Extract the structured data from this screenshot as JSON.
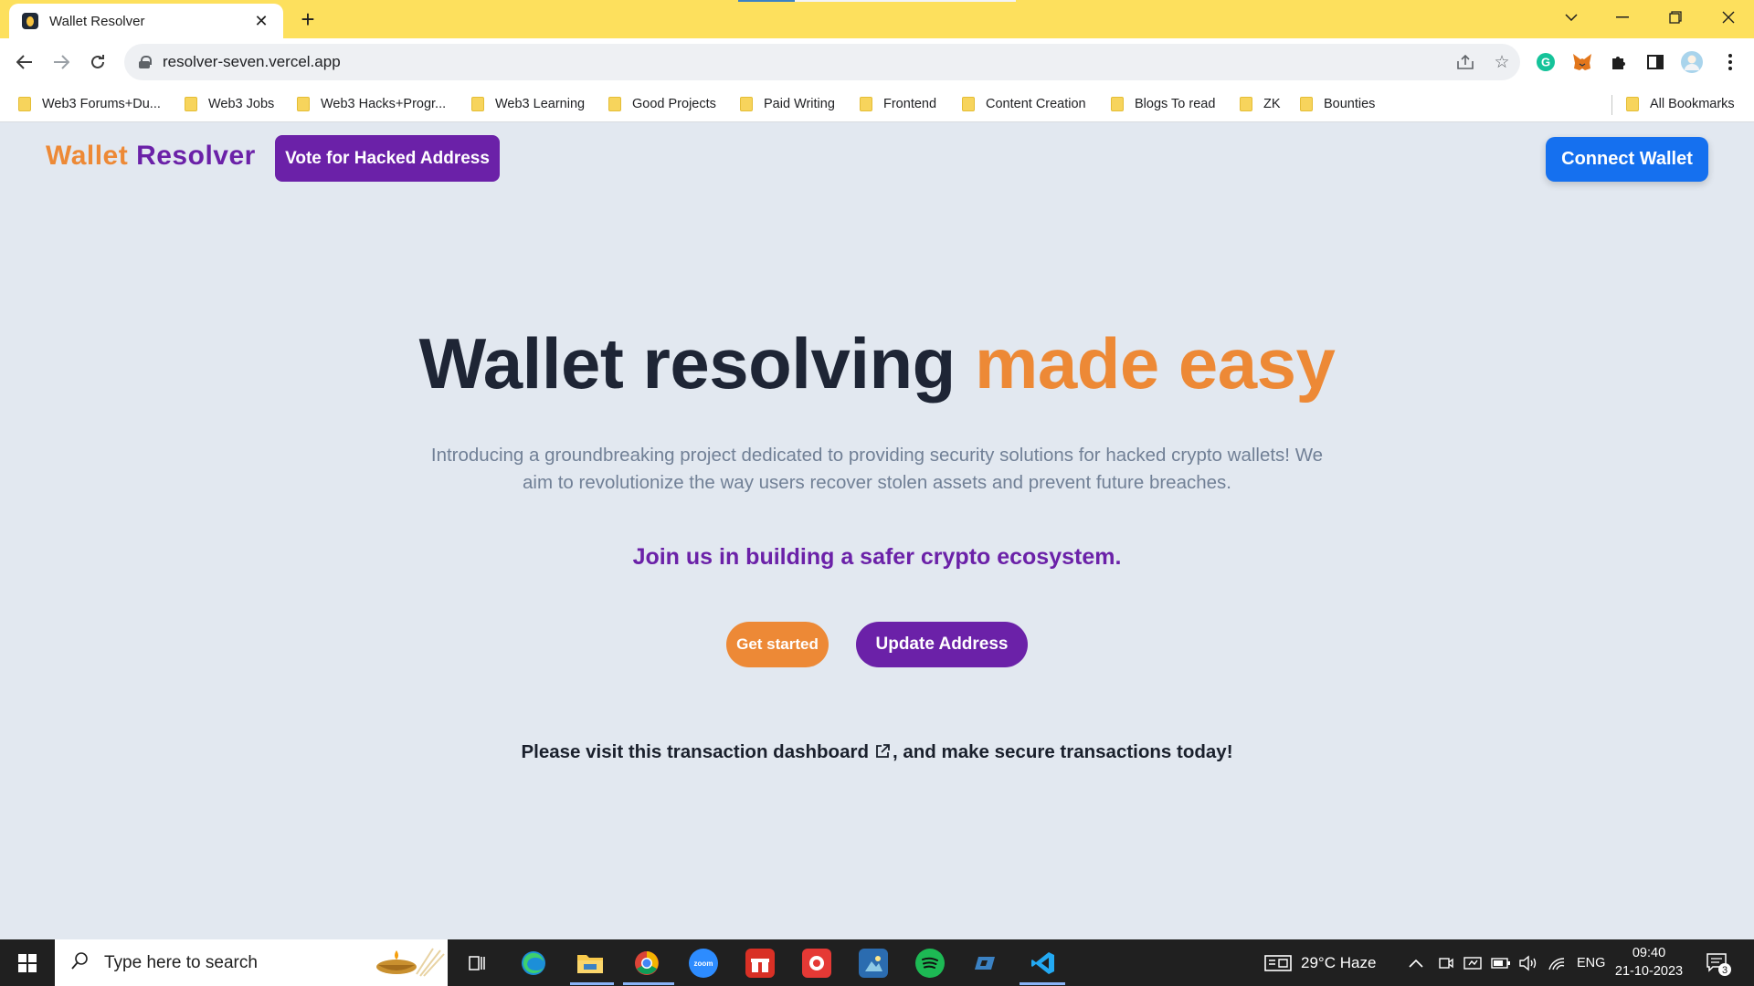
{
  "browser": {
    "tab_title": "Wallet Resolver",
    "url": "resolver-seven.vercel.app",
    "bookmarks": [
      "Web3 Forums+Du...",
      "Web3 Jobs",
      "Web3 Hacks+Progr...",
      "Web3 Learning",
      "Good Projects",
      "Paid Writing",
      "Frontend",
      "Content Creation",
      "Blogs To read",
      "ZK",
      "Bounties"
    ],
    "all_bookmarks": "All Bookmarks"
  },
  "nav": {
    "brand_first": "Wallet",
    "brand_second": "Resolver",
    "vote_label": "Vote for Hacked Address",
    "connect_label": "Connect Wallet"
  },
  "hero": {
    "title_main": "Wallet resolving",
    "title_accent": "made easy",
    "description": "Introducing a groundbreaking project dedicated to providing security solutions for hacked crypto wallets! We aim to revolutionize the way users recover stolen assets and prevent future breaches.",
    "join_text": "Join us in building a safer crypto ecosystem.",
    "get_started_label": "Get started",
    "update_address_label": "Update Address",
    "visit_prefix": "Please visit this transaction dashboard",
    "visit_suffix": ", and make secure transactions today!"
  },
  "taskbar": {
    "search_placeholder": "Type here to search",
    "weather": "29°C  Haze",
    "language": "ENG",
    "time": "09:40",
    "date": "21-10-2023",
    "notification_count": "3"
  },
  "colors": {
    "accent_orange": "#ed8936",
    "accent_purple": "#6b21a8",
    "connect_blue": "#1570ef",
    "page_bg": "#e2e8f0",
    "tab_bar": "#fde05d"
  }
}
